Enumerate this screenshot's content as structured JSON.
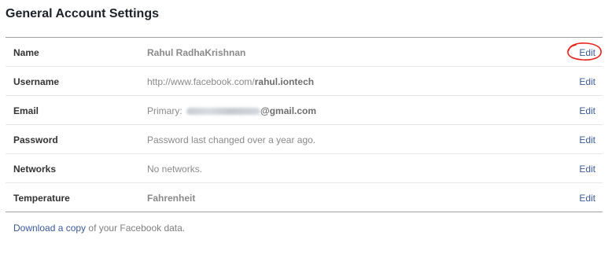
{
  "page": {
    "title": "General Account Settings"
  },
  "settings": [
    {
      "label": "Name",
      "value": "Rahul RadhaKrishnan",
      "action": "Edit"
    },
    {
      "label": "Username",
      "value_prefix": "http://www.facebook.com/",
      "value_strong": "rahul.iontech",
      "action": "Edit"
    },
    {
      "label": "Email",
      "value_prefix": "Primary: ",
      "value_strong": "@gmail.com",
      "action": "Edit"
    },
    {
      "label": "Password",
      "value": "Password last changed over a year ago.",
      "action": "Edit"
    },
    {
      "label": "Networks",
      "value": "No networks.",
      "action": "Edit"
    },
    {
      "label": "Temperature",
      "value": "Fahrenheit",
      "action": "Edit"
    }
  ],
  "footer": {
    "link_text": "Download a copy",
    "suffix_text": " of your Facebook data."
  },
  "colors": {
    "link": "#3b5998",
    "annotation_circle": "#e8221b"
  }
}
